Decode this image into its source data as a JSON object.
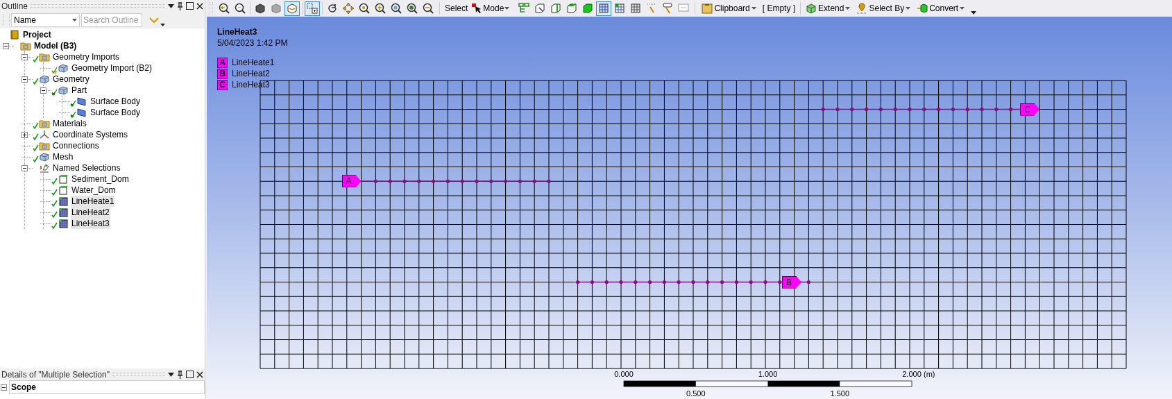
{
  "outline": {
    "title": "Outline",
    "filter": "Name",
    "search": {
      "placeholder": "Search Outline"
    },
    "tree": [
      {
        "label": "Project",
        "kind": "book",
        "ok": false,
        "crossed": false,
        "bold": true,
        "selected": false
      },
      {
        "label": "Model (B3)",
        "kind": "folder",
        "ok": false,
        "crossed": false,
        "bold": true,
        "selected": false,
        "expanded": true,
        "children": [
          {
            "label": "Geometry Imports",
            "kind": "folder",
            "ok": true,
            "crossed": false,
            "bold": false,
            "selected": false,
            "expanded": true,
            "children": [
              {
                "label": "Geometry Import (B2)",
                "kind": "import",
                "ok": true,
                "crossed": false,
                "bold": false,
                "selected": false
              }
            ]
          },
          {
            "label": "Geometry",
            "kind": "solid",
            "ok": true,
            "crossed": false,
            "bold": false,
            "selected": false,
            "expanded": true,
            "children": [
              {
                "label": "Part",
                "kind": "solid",
                "ok": true,
                "crossed": true,
                "bold": false,
                "selected": false,
                "expanded": true,
                "children": [
                  {
                    "label": "Surface Body",
                    "kind": "surface",
                    "ok": true,
                    "crossed": true,
                    "bold": false,
                    "selected": false
                  },
                  {
                    "label": "Surface Body",
                    "kind": "surface",
                    "ok": true,
                    "crossed": true,
                    "bold": false,
                    "selected": false
                  }
                ]
              }
            ]
          },
          {
            "label": "Materials",
            "kind": "folder",
            "ok": true,
            "crossed": false,
            "bold": false,
            "selected": false
          },
          {
            "label": "Coordinate Systems",
            "kind": "axes",
            "ok": true,
            "crossed": false,
            "bold": false,
            "selected": false,
            "expanded": false
          },
          {
            "label": "Connections",
            "kind": "folder",
            "ok": true,
            "crossed": false,
            "bold": false,
            "selected": false
          },
          {
            "label": "Mesh",
            "kind": "solid",
            "ok": true,
            "crossed": false,
            "bold": false,
            "selected": false
          },
          {
            "label": "Named Selections",
            "kind": "named",
            "ok": false,
            "crossed": false,
            "bold": false,
            "selected": false,
            "expanded": true,
            "children": [
              {
                "label": "Sediment_Dom",
                "kind": "face",
                "ok": true,
                "crossed": false,
                "bold": false,
                "selected": false
              },
              {
                "label": "Water_Dom",
                "kind": "face",
                "ok": true,
                "crossed": false,
                "bold": false,
                "selected": false
              },
              {
                "label": "LineHeate1",
                "kind": "edge",
                "ok": true,
                "crossed": false,
                "bold": false,
                "selected": true
              },
              {
                "label": "LineHeat2",
                "kind": "edge",
                "ok": true,
                "crossed": false,
                "bold": false,
                "selected": true
              },
              {
                "label": "LineHeat3",
                "kind": "edge",
                "ok": true,
                "crossed": false,
                "bold": false,
                "selected": true
              }
            ]
          }
        ]
      }
    ]
  },
  "details": {
    "title": "Details of \"Multiple Selection\"",
    "section": "Scope",
    "expanded": true
  },
  "toolbar": {
    "tools": [
      {
        "kind": "zoom-back",
        "selected": false
      },
      {
        "kind": "zoom-forward",
        "selected": false
      },
      {
        "kind": "cube-dark",
        "selected": false
      },
      {
        "kind": "cube-light",
        "selected": false
      },
      {
        "kind": "cube-select",
        "selected": true
      },
      {
        "kind": "box-select",
        "selected": true
      },
      {
        "kind": "rotate",
        "selected": false
      },
      {
        "kind": "pan",
        "selected": false
      },
      {
        "kind": "zoom",
        "selected": false
      },
      {
        "kind": "zoom-in",
        "selected": false
      },
      {
        "kind": "zoom-box",
        "selected": false
      },
      {
        "kind": "zoom-fit",
        "selected": false
      },
      {
        "kind": "zoom-out",
        "selected": false
      }
    ],
    "select_label": "Select",
    "mode_label": "Mode",
    "select_tools": [
      {
        "kind": "tree-select",
        "selected": false
      },
      {
        "kind": "vertex",
        "selected": false
      },
      {
        "kind": "edge",
        "selected": false
      },
      {
        "kind": "face",
        "selected": false
      },
      {
        "kind": "body",
        "selected": false
      },
      {
        "kind": "mesh-node",
        "selected": true
      },
      {
        "kind": "mesh-element",
        "selected": false
      },
      {
        "kind": "mesh-face",
        "selected": false
      },
      {
        "kind": "xyz",
        "selected": false
      },
      {
        "kind": "id",
        "selected": false
      },
      {
        "kind": "label",
        "selected": false
      }
    ],
    "menus": [
      {
        "label": "Clipboard",
        "kind": "clipboard"
      },
      {
        "label": "[ Empty ]",
        "kind": "plain"
      },
      {
        "label": "Extend",
        "kind": "extend"
      },
      {
        "label": "Select By",
        "kind": "select-by"
      },
      {
        "label": "Convert",
        "kind": "convert"
      }
    ]
  },
  "viewport": {
    "title": "LineHeat3",
    "timestamp": "5/04/2023 1:42 PM",
    "legend": [
      {
        "letter": "A",
        "label": "LineHeate1"
      },
      {
        "letter": "B",
        "label": "LineHeat2"
      },
      {
        "letter": "C",
        "label": "LineHeat3"
      }
    ],
    "flags": [
      {
        "letter": "A"
      },
      {
        "letter": "B"
      },
      {
        "letter": "C"
      }
    ],
    "scale": {
      "top_labels": [
        "0.000",
        "1.000",
        "2.000"
      ],
      "unit": "(m)",
      "bottom_labels": [
        "0.500",
        "1.500"
      ]
    }
  }
}
